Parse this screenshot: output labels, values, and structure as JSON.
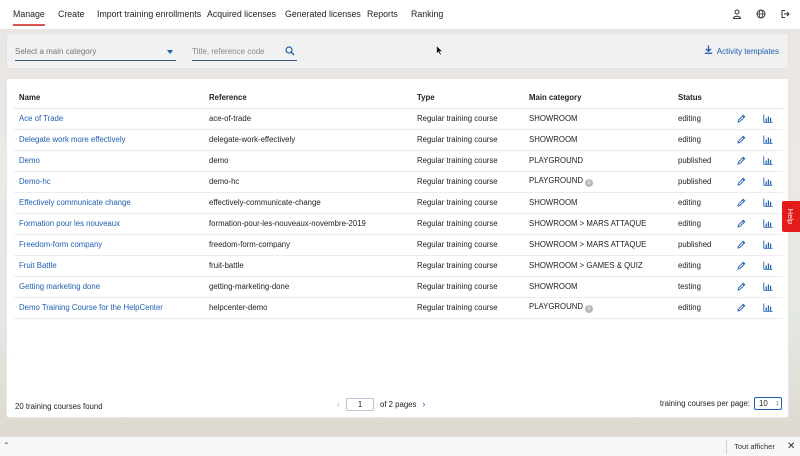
{
  "nav": {
    "tabs": [
      {
        "label": "Manage",
        "active": true
      },
      {
        "label": "Create"
      },
      {
        "label": "Import training enrollments"
      },
      {
        "label": "Acquired licenses"
      },
      {
        "label": "Generated licenses"
      },
      {
        "label": "Reports"
      },
      {
        "label": "Ranking"
      }
    ],
    "icons": [
      "user-icon",
      "globe-icon",
      "logout-icon"
    ]
  },
  "filters": {
    "category_placeholder": "Select a main category",
    "search_placeholder": "Title, reference code",
    "activity_templates_label": "Activity templates"
  },
  "table": {
    "columns": [
      "Name",
      "Reference",
      "Type",
      "Main category",
      "Status"
    ],
    "rows": [
      {
        "name": "Ace of Trade",
        "reference": "ace-of-trade",
        "type": "Regular training course",
        "category": "SHOWROOM",
        "status": "editing",
        "info": false
      },
      {
        "name": "Delegate work more effectively",
        "reference": "delegate-work-effectively",
        "type": "Regular training course",
        "category": "SHOWROOM",
        "status": "editing",
        "info": false
      },
      {
        "name": "Demo",
        "reference": "demo",
        "type": "Regular training course",
        "category": "PLAYGROUND",
        "status": "published",
        "info": false
      },
      {
        "name": "Demo-hc",
        "reference": "demo-hc",
        "type": "Regular training course",
        "category": "PLAYGROUND",
        "status": "published",
        "info": true
      },
      {
        "name": "Effectively communicate change",
        "reference": "effectively-communicate-change",
        "type": "Regular training course",
        "category": "SHOWROOM",
        "status": "editing",
        "info": false
      },
      {
        "name": "Formation pour les nouveaux",
        "reference": "formation-pour-les-nouveaux-novembre-2019",
        "type": "Regular training course",
        "category": "SHOWROOM > MARS ATTAQUE",
        "status": "editing",
        "info": false
      },
      {
        "name": "Freedom-form company",
        "reference": "freedom-form-company",
        "type": "Regular training course",
        "category": "SHOWROOM > MARS ATTAQUE",
        "status": "published",
        "info": false
      },
      {
        "name": "Fruit Battle",
        "reference": "fruit-battle",
        "type": "Regular training course",
        "category": "SHOWROOM > GAMES & QUIZ",
        "status": "editing",
        "info": false
      },
      {
        "name": "Getting marketing done",
        "reference": "getting-marketing-done",
        "type": "Regular training course",
        "category": "SHOWROOM",
        "status": "testing",
        "info": false
      },
      {
        "name": "Demo Training Course for the HelpCenter",
        "reference": "helpcenter-demo",
        "type": "Regular training course",
        "category": "PLAYGROUND",
        "status": "editing",
        "info": true
      }
    ]
  },
  "footer": {
    "found_text": "20 training courses found",
    "current_page": "1",
    "of_pages_text": "of 2 pages",
    "per_page_label": "training courses per page:",
    "per_page_value": "10"
  },
  "help_label": "Help",
  "bottom_bar": {
    "show_all_label": "Tout afficher",
    "close_glyph": "✕"
  },
  "colors": {
    "accent": "#1f5fb0",
    "active_tab_underline": "#d9534f",
    "help_tab": "#e31b1b"
  }
}
